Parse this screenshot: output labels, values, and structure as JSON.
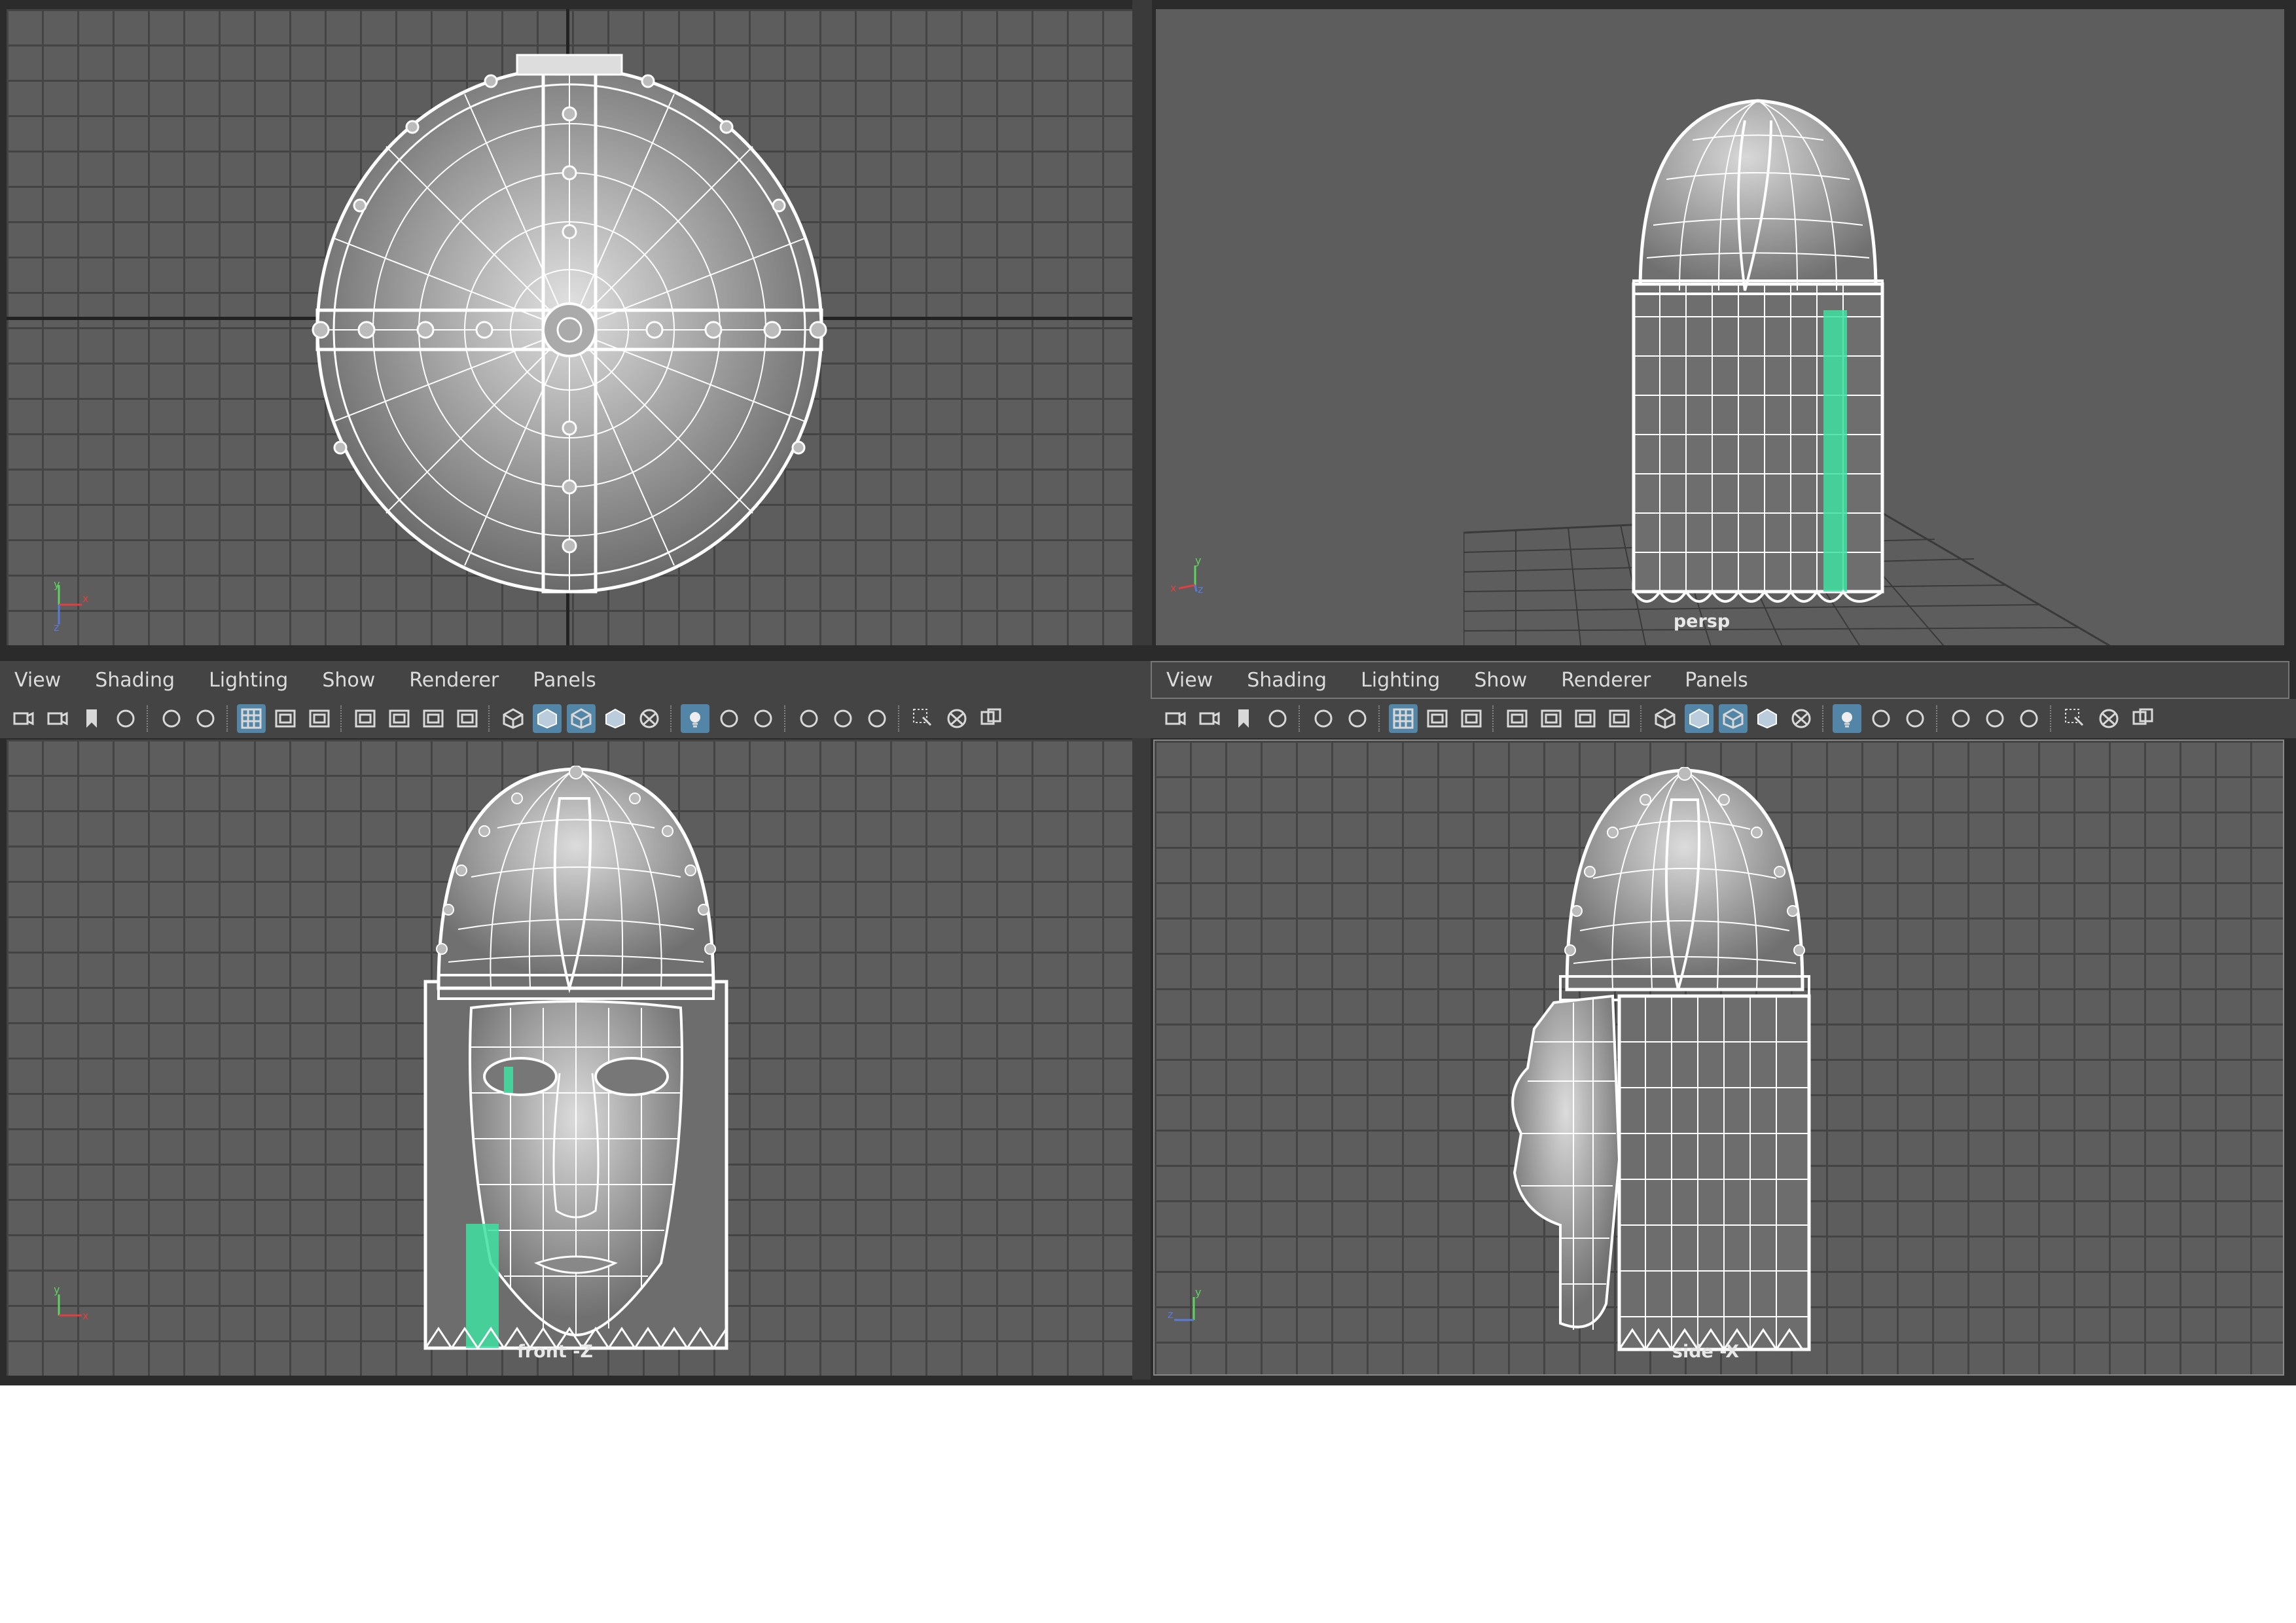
{
  "menus": {
    "left": [
      "View",
      "Shading",
      "Lighting",
      "Show",
      "Renderer",
      "Panels"
    ],
    "right": [
      "View",
      "Shading",
      "Lighting",
      "Show",
      "Renderer",
      "Panels"
    ]
  },
  "viewports": {
    "top": {
      "label": ""
    },
    "persp": {
      "label": "persp"
    },
    "front": {
      "label": "front -Z"
    },
    "side": {
      "label": "side -X"
    }
  },
  "toolbar_icons": [
    "select-camera-icon",
    "camera-attributes-icon",
    "bookmark-icon",
    "image-plane-icon",
    "2d-pan-zoom-icon",
    "grease-pencil-icon",
    "grid-icon",
    "film-gate-icon",
    "resolution-gate-icon",
    "gate-mask-icon",
    "field-chart-icon",
    "safe-action-icon",
    "safe-title-icon",
    "wireframe-icon",
    "smooth-shade-icon",
    "wireframe-on-shaded-icon",
    "default-material-icon",
    "xray-icon",
    "use-all-lights-icon",
    "shadows-icon",
    "screen-space-ao-icon",
    "motion-blur-icon",
    "anti-alias-icon",
    "depth-of-field-icon",
    "isolate-select-icon",
    "xray-joints-icon",
    "panel-layout-icon"
  ],
  "colors": {
    "viewport_bg": "#5d5d5d",
    "grid": "#444444",
    "menubar_bg": "#444444",
    "active_button": "#5285a6",
    "wire": "#ffffff",
    "selection": "#3fe0a0"
  }
}
